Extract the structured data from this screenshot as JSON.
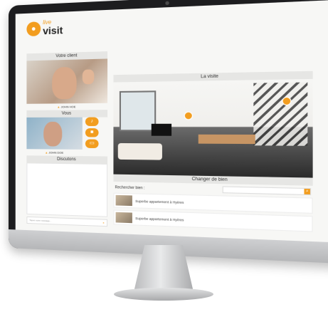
{
  "header": {
    "logo_live": "live",
    "logo_visit": "visit"
  },
  "left": {
    "client_title": "Votre client",
    "client_name": "JOHN HOE",
    "vous_title": "Vous",
    "vous_name": "JOHN DOE",
    "chat_title": "Discutons",
    "chat_placeholder": "Tapez votre message..."
  },
  "right": {
    "room_title": "La visite",
    "change_title": "Changer de bien",
    "search_label": "Rechercher bien :",
    "listings": [
      {
        "title": "Superbe appartement à Hyères"
      },
      {
        "title": "Superbe appartement à Hyères"
      }
    ]
  },
  "colors": {
    "accent": "#f29d1f",
    "bezel": "#1d1d1f"
  },
  "icons": [
    "mic-icon",
    "camera-icon",
    "screen-share-icon",
    "send-icon",
    "search-icon",
    "location-pin-icon"
  ]
}
